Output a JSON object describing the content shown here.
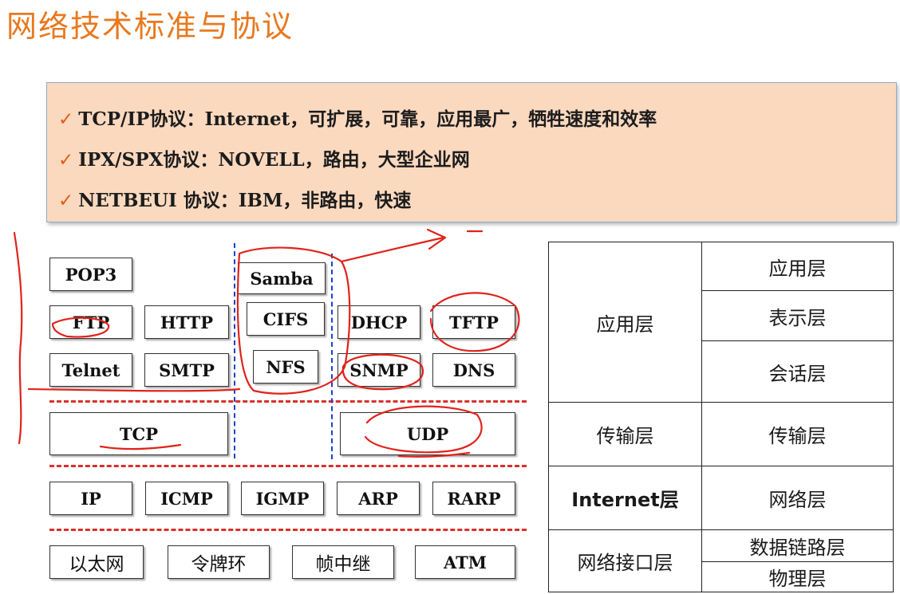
{
  "title": "网络技术标准与协议",
  "bullets": [
    "TCP/IP协议：Internet，可扩展，可靠，应用最广，牺牲速度和效率",
    "IPX/SPX协议：NOVELL，路由，大型企业网",
    "NETBEUI 协议：IBM，非路由，快速"
  ],
  "check_mark": "✓",
  "protocols": {
    "pop3": "POP3",
    "ftp": "FTP",
    "http": "HTTP",
    "telnet": "Telnet",
    "smtp": "SMTP",
    "samba": "Samba",
    "cifs": "CIFS",
    "nfs": "NFS",
    "dhcp": "DHCP",
    "tftp": "TFTP",
    "snmp": "SNMP",
    "dns": "DNS",
    "tcp": "TCP",
    "udp": "UDP",
    "ip": "IP",
    "icmp": "ICMP",
    "igmp": "IGMP",
    "arp": "ARP",
    "rarp": "RARP",
    "ethernet": "以太网",
    "token_ring": "令牌环",
    "frame_relay": "帧中继",
    "atm": "ATM"
  },
  "layer_table": {
    "tcpip": {
      "application": "应用层",
      "transport": "传输层",
      "internet": "Internet层",
      "network_interface": "网络接口层"
    },
    "osi": {
      "application": "应用层",
      "presentation": "表示层",
      "session": "会话层",
      "transport": "传输层",
      "network": "网络层",
      "data_link": "数据链路层",
      "physical": "物理层"
    }
  }
}
